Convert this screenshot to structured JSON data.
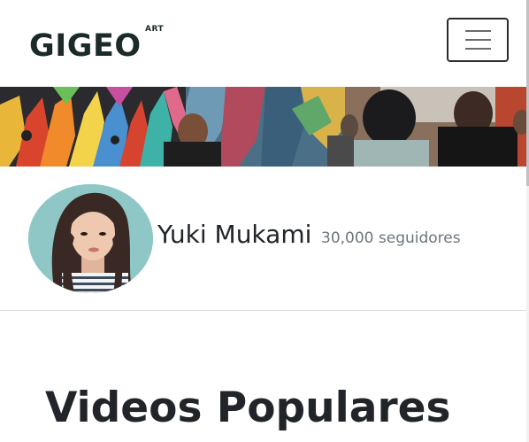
{
  "brand": {
    "name": "GIGEO",
    "superscript": "ART"
  },
  "navbar": {
    "toggler_icon": "hamburger-menu-icon"
  },
  "banner": {
    "description_icon": "street-graffiti-banner-image"
  },
  "profile": {
    "name": "Yuki Mukami",
    "followers": "30,000 seguidores",
    "avatar_icon": "profile-photo"
  },
  "section": {
    "title": "Videos Populares"
  },
  "colors": {
    "text": "#212529",
    "muted": "#6c757d",
    "divider": "#dedede",
    "brand": "#1c2a2a"
  }
}
